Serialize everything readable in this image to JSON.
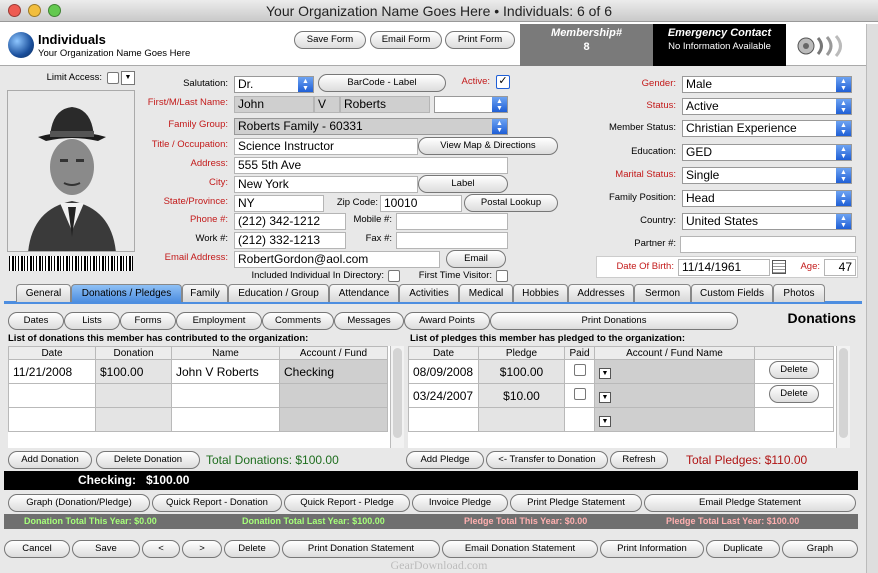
{
  "window": {
    "title": "Your Organization Name Goes Here  •  Individuals: 6 of 6"
  },
  "header": {
    "section": "Individuals",
    "org_name": "Your Organization Name Goes Here",
    "save_form": "Save Form",
    "email_form": "Email Form",
    "print_form": "Print Form",
    "membership_label": "Membership#",
    "membership_value": "8",
    "emergency_label": "Emergency Contact",
    "emergency_value": "No Information Available"
  },
  "left": {
    "limit_access": "Limit Access:"
  },
  "form": {
    "salutation_label": "Salutation:",
    "salutation": "Dr.",
    "barcode_button": "BarCode - Label",
    "active_label": "Active:",
    "active_checked": "✓",
    "name_label": "First/M/Last Name:",
    "first": "John",
    "middle": "V",
    "last": "Roberts",
    "family_group_label": "Family Group:",
    "family_group": "Roberts Family - 60331",
    "title_label": "Title / Occupation:",
    "title": "Science Instructor",
    "map_button": "View Map & Directions",
    "address_label": "Address:",
    "address": "555 5th Ave",
    "city_label": "City:",
    "city": "New York",
    "label_button": "Label",
    "state_label": "State/Province:",
    "state": "NY",
    "zip_label": "Zip Code:",
    "zip": "10010",
    "postal_button": "Postal Lookup",
    "phone_label": "Phone #:",
    "phone": "(212) 342-1212",
    "mobile_label": "Mobile #:",
    "work_label": "Work #:",
    "work": "(212) 332-1213",
    "fax_label": "Fax #:",
    "email_label": "Email Address:",
    "email": "RobertGordon@aol.com",
    "email_button": "Email",
    "directory_label": "Included Individual In Directory:",
    "first_time_label": "First Time Visitor:",
    "gender_label": "Gender:",
    "gender": "Male",
    "status_label": "Status:",
    "status": "Active",
    "member_status_label": "Member Status:",
    "member_status": "Christian Experience",
    "education_label": "Education:",
    "education": "GED",
    "marital_label": "Marital Status:",
    "marital": "Single",
    "family_position_label": "Family Position:",
    "family_position": "Head",
    "country_label": "Country:",
    "country": "United States",
    "partner_label": "Partner #:",
    "dob_label": "Date Of Birth:",
    "dob": "11/14/1961",
    "age_label": "Age:",
    "age": "47"
  },
  "tabs": [
    "General",
    "Donations / Pledges",
    "Family",
    "Education / Group",
    "Attendance",
    "Activities",
    "Medical",
    "Hobbies",
    "Addresses",
    "Sermon",
    "Custom Fields",
    "Photos"
  ],
  "subtabs": [
    "Dates",
    "Lists",
    "Forms",
    "Employment",
    "Comments",
    "Messages",
    "Award Points",
    "Print Donations"
  ],
  "panel_title": "Donations",
  "donations": {
    "caption": "List of donations this member has contributed to the organization:",
    "headers": [
      "Date",
      "Donation",
      "Name",
      "Account / Fund"
    ],
    "rows": [
      [
        "11/21/2008",
        "$100.00",
        "John V Roberts",
        "Checking"
      ]
    ]
  },
  "pledges": {
    "caption": "List of pledges this member has pledged to the organization:",
    "headers": [
      "Date",
      "Pledge",
      "Paid",
      "Account / Fund Name"
    ],
    "rows": [
      [
        "08/09/2008",
        "$100.00"
      ],
      [
        "03/24/2007",
        "$10.00"
      ]
    ],
    "delete": "Delete"
  },
  "actions": {
    "add_donation": "Add Donation",
    "delete_donation": "Delete Donation",
    "total_donations": "Total Donations:  $100.00",
    "add_pledge": "Add Pledge",
    "transfer": "<- Transfer to Donation",
    "refresh": "Refresh",
    "total_pledges": "Total Pledges: $110.00"
  },
  "checking": {
    "label": "Checking:",
    "value": "$100.00"
  },
  "reports": [
    "Graph (Donation/Pledge)",
    "Quick Report - Donation",
    "Quick Report - Pledge",
    "Invoice Pledge",
    "Print Pledge Statement",
    "Email Pledge Statement"
  ],
  "summary": {
    "donation_this_year": "Donation Total This Year: $0.00",
    "donation_last_year": "Donation Total Last Year: $100.00",
    "pledge_this_year": "Pledge Total This Year: $0.00",
    "pledge_last_year": "Pledge Total Last Year: $100.00"
  },
  "bottom": [
    "Cancel",
    "Save",
    "<",
    ">",
    "Delete",
    "Print Donation Statement",
    "Email Donation Statement",
    "Print Information",
    "Duplicate",
    "Graph"
  ],
  "watermark": "GearDownload.com",
  "colors": {
    "accent": "#4d8ee0",
    "required_label": "#c31a1a",
    "green_total": "#1f6e1f",
    "red_total": "#b01414"
  }
}
